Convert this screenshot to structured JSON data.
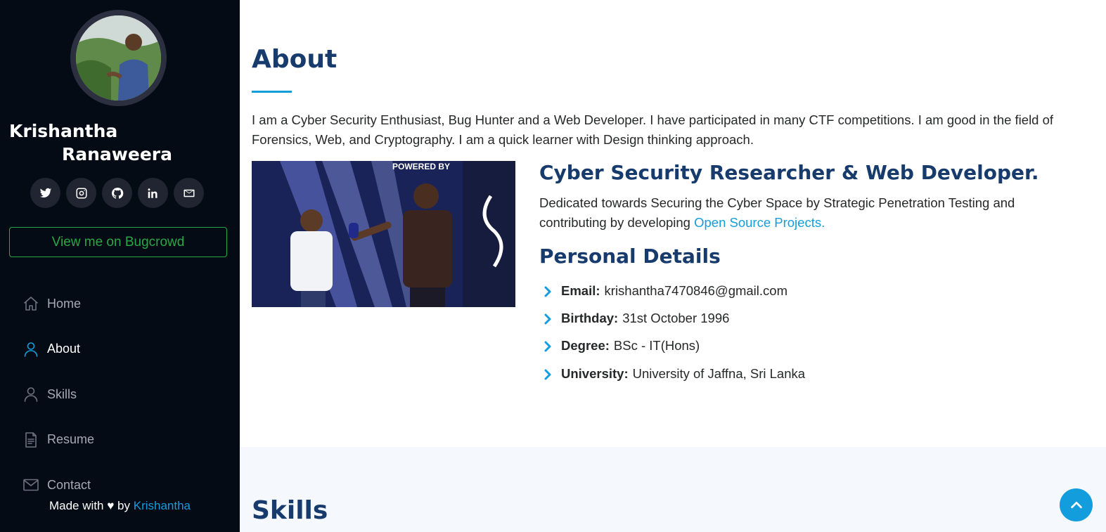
{
  "sidebar": {
    "name_line1": "Krishantha",
    "name_line2": "Ranaweera",
    "socials": [
      {
        "icon": "twitter-icon"
      },
      {
        "icon": "instagram-icon"
      },
      {
        "icon": "github-icon"
      },
      {
        "icon": "linkedin-icon"
      },
      {
        "icon": "mail-icon"
      }
    ],
    "bugcrowd_label": "View me on Bugcrowd",
    "nav": [
      {
        "label": "Home",
        "icon": "home-icon",
        "active": false
      },
      {
        "label": "About",
        "icon": "person-icon",
        "active": true
      },
      {
        "label": "Skills",
        "icon": "person-icon",
        "active": false
      },
      {
        "label": "Resume",
        "icon": "file-text-icon",
        "active": false
      },
      {
        "label": "Contact",
        "icon": "envelope-icon",
        "active": false
      }
    ],
    "footer": {
      "made_with": "Made with",
      "heart": "♥",
      "by": "by",
      "author": "Krishantha"
    }
  },
  "about": {
    "title": "About",
    "intro": "I am a Cyber Security Enthusiast, Bug Hunter and a Web Developer. I have participated in many CTF competitions. I am good in the field of Forensics, Web, and Cryptography. I am a quick learner with Design thinking approach.",
    "role": "Cyber Security Researcher & Web Developer.",
    "role_desc": "Dedicated towards Securing the Cyber Space by Strategic Penetration Testing and contributing by developing",
    "role_link": "Open Source Projects.",
    "personal_title": "Personal Details",
    "details": [
      {
        "label": "Email:",
        "value": "krishantha7470846@gmail.com"
      },
      {
        "label": "Birthday:",
        "value": "31st October 1996"
      },
      {
        "label": "Degree:",
        "value": "BSc - IT(Hons)"
      },
      {
        "label": "University:",
        "value": "University of Jaffna, Sri Lanka"
      }
    ]
  },
  "skills": {
    "title": "Skills"
  },
  "colors": {
    "sidebar_bg": "#040b14",
    "accent": "#149ddd",
    "heading": "#173b6c",
    "bugcrowd_green": "#28a745"
  }
}
